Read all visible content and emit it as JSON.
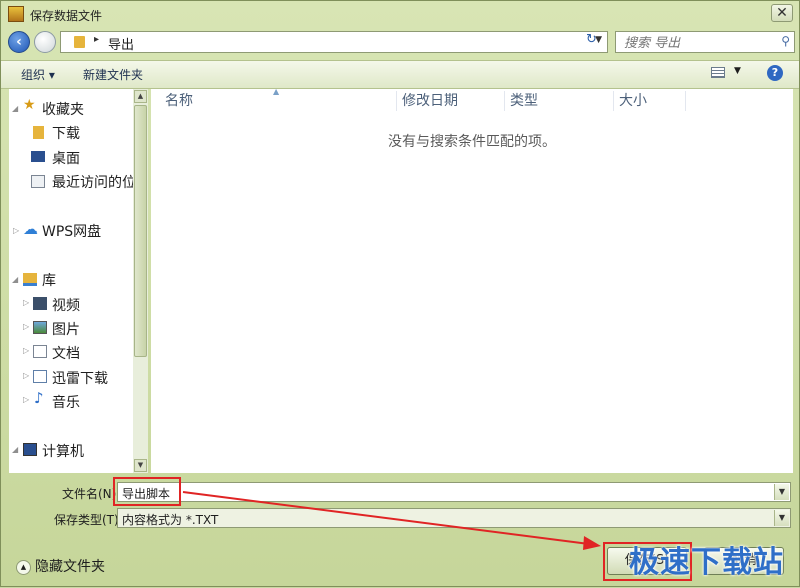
{
  "window": {
    "title": "保存数据文件",
    "close_label": "✕"
  },
  "address": {
    "path_label": "导出",
    "arrow": "▸"
  },
  "search": {
    "placeholder": "搜索 导出"
  },
  "toolbar": {
    "organize_label": "组织 ▾",
    "new_folder_label": "新建文件夹",
    "help_label": "?"
  },
  "nav": {
    "items": [
      {
        "label": "收藏夹",
        "icon": "star-icon"
      },
      {
        "label": "下载",
        "icon": "folder-icon"
      },
      {
        "label": "桌面",
        "icon": "desktop-icon"
      },
      {
        "label": "最近访问的位",
        "icon": "recent-icon"
      },
      {
        "label": "WPS网盘",
        "icon": "cloud-icon"
      },
      {
        "label": "库",
        "icon": "library-icon"
      },
      {
        "label": "视频",
        "icon": "video-icon"
      },
      {
        "label": "图片",
        "icon": "picture-icon"
      },
      {
        "label": "文档",
        "icon": "document-icon"
      },
      {
        "label": "迅雷下载",
        "icon": "thunder-icon"
      },
      {
        "label": "音乐",
        "icon": "music-icon"
      },
      {
        "label": "计算机",
        "icon": "computer-icon"
      }
    ]
  },
  "file_list": {
    "columns": [
      "名称",
      "修改日期",
      "类型",
      "大小"
    ],
    "empty_message": "没有与搜索条件匹配的项。"
  },
  "save_form": {
    "filename_label": "文件名(N):",
    "filename_value": "导出脚本",
    "filetype_label": "保存类型(T):",
    "filetype_value": "内容格式为 *.TXT"
  },
  "footer": {
    "hide_folders_label": "隐藏文件夹",
    "save_button_label": "保存(S)",
    "cancel_button_label": "取消"
  },
  "watermark": "极速下载站",
  "colors": {
    "highlight": "#e02424",
    "accent": "#2f6fc8"
  }
}
